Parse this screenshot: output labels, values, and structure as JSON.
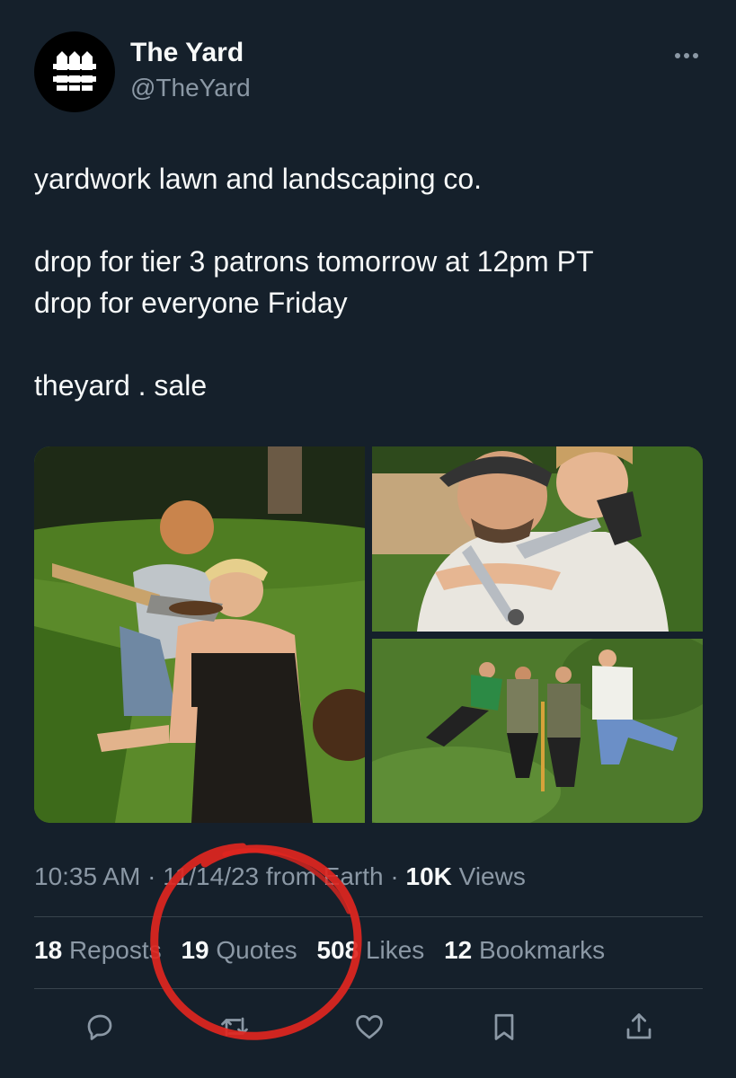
{
  "author": {
    "name": "The Yard",
    "handle": "@TheYard",
    "avatar_icon": "fence-logo-icon"
  },
  "tweet": {
    "line1": "yardwork lawn and landscaping co.",
    "line2": "drop for tier 3 patrons tomorrow at 12pm PT\ndrop for everyone Friday",
    "line3": "theyard . sale"
  },
  "media": [
    {
      "icon": "photo-shovel-lawn"
    },
    {
      "icon": "photo-hedge-shears"
    },
    {
      "icon": "photo-group-lying-on-grass"
    }
  ],
  "meta": {
    "time": "10:35 AM",
    "separator": " · ",
    "date": "11/14/23",
    "source": " from Earth",
    "views_count": "10K",
    "views_label": " Views"
  },
  "stats": {
    "reposts_count": "18",
    "reposts_label": "Reposts",
    "quotes_count": "19",
    "quotes_label": "Quotes",
    "likes_count": "508",
    "likes_label": "Likes",
    "bookmarks_count": "12",
    "bookmarks_label": "Bookmarks"
  },
  "actions": [
    "reply-icon",
    "repost-icon",
    "like-icon",
    "bookmark-icon",
    "share-icon"
  ],
  "colors": {
    "background": "#15202b",
    "primary_text": "#f7f9f9",
    "secondary_text": "#8b98a5",
    "divider": "#38444d",
    "annotation": "#e0261f"
  }
}
